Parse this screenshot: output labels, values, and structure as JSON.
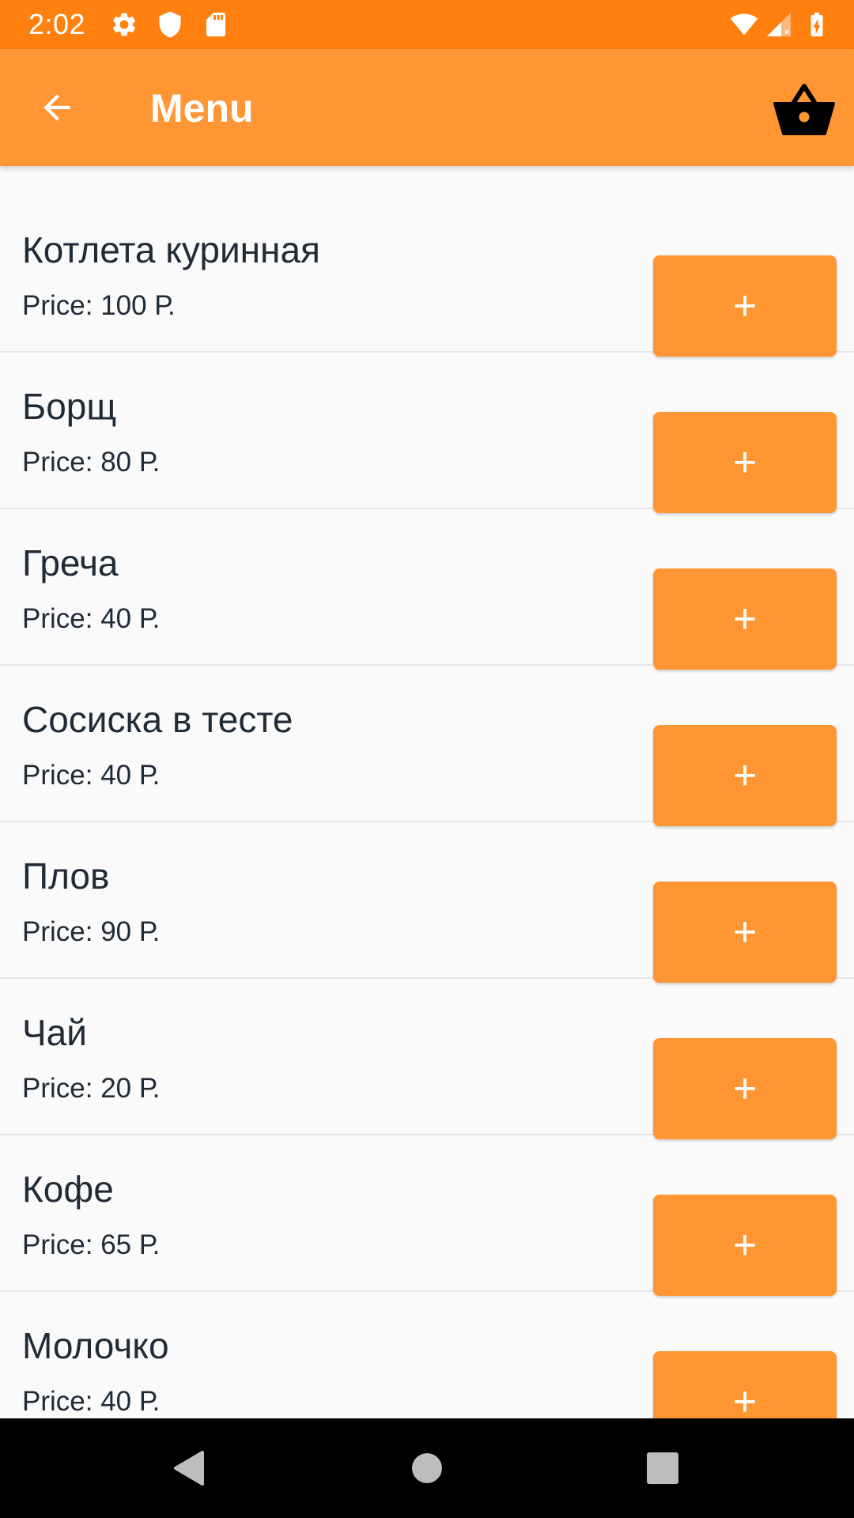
{
  "status_bar": {
    "time": "2:02",
    "icons": [
      "settings-icon",
      "shield-icon",
      "sd-card-icon",
      "wifi-icon",
      "signal-icon",
      "battery-icon"
    ]
  },
  "app_bar": {
    "title": "Menu",
    "back_icon": "arrow-back-icon",
    "cart_icon": "basket-icon"
  },
  "menu": {
    "items": [
      {
        "name": "Котлета куринная",
        "price": "Price: 100 Р.",
        "button": "+"
      },
      {
        "name": "Борщ",
        "price": "Price: 80 Р.",
        "button": "+"
      },
      {
        "name": "Греча",
        "price": "Price: 40 Р.",
        "button": "+"
      },
      {
        "name": "Сосиска в тесте",
        "price": "Price: 40 Р.",
        "button": "+"
      },
      {
        "name": "Плов",
        "price": "Price: 90 Р.",
        "button": "+"
      },
      {
        "name": "Чай",
        "price": "Price: 20 Р.",
        "button": "+"
      },
      {
        "name": "Кофе",
        "price": "Price: 65 Р.",
        "button": "+"
      },
      {
        "name": "Молочко",
        "price": "Price: 40 Р.",
        "button": "+"
      }
    ]
  },
  "colors": {
    "status_bar": "#FF7F0F",
    "app_bar": "#FF9633",
    "button": "#FF9633",
    "background": "#FAFAFA",
    "text": "#212B36"
  },
  "nav_bar": {
    "icons": [
      "back-triangle-icon",
      "home-circle-icon",
      "recents-square-icon"
    ]
  }
}
